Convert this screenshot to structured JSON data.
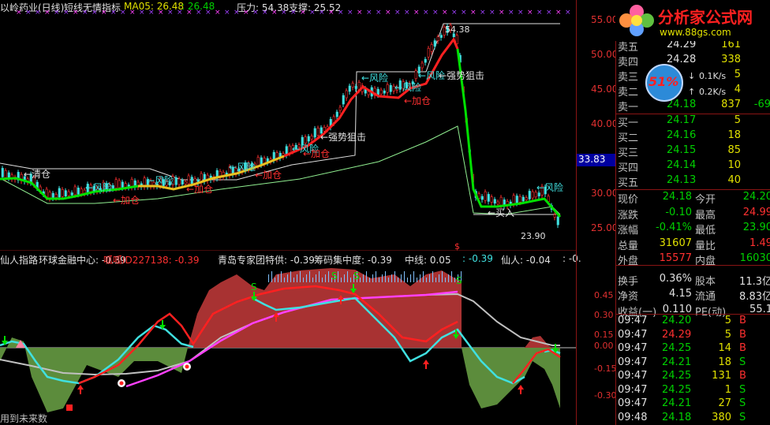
{
  "header": {
    "stock_title": "以岭药业(日线)",
    "indicator_name": "短线无情指标",
    "ma_label": "MA05: 26.48",
    "ma_value2": ": 26.48",
    "pressure": "压力: 54.38",
    "support": "支撑: 25.52"
  },
  "main_chart": {
    "y_ticks": [
      "55.00",
      "50.00",
      "45.00",
      "40.00",
      "35.00",
      "30.00",
      "25.00"
    ],
    "current_price_tag": "33.83",
    "high_label": "54.38",
    "low_label": "23.90",
    "annotations": {
      "qingcang": "←清仓",
      "fengxian": "←风险",
      "jiacang": "←加仓",
      "qiangshi": "←强势狙击",
      "mairu": "←买入"
    }
  },
  "indicator": {
    "name": "仙人指路",
    "items": [
      {
        "label": "环球金融中心: -0.39",
        "color": "#e0e0e0"
      },
      {
        "label": "呱呱ID227138: -0.39",
        "color": "#ff3030"
      },
      {
        "label": "青岛专家团特供: -0.39",
        "color": "#e0e0e0"
      },
      {
        "label": "筹码集中度: -0.39",
        "color": "#e0e0e0"
      },
      {
        "label": "中线: 0.05",
        "color": "#e0e0e0"
      },
      {
        "label": ": -0.39",
        "color": "#40e0e0"
      },
      {
        "label": "仙人: -0.04",
        "color": "#e0e0e0"
      },
      {
        "label": ": -0.",
        "color": "#e0e0e0"
      }
    ],
    "y_ticks": [
      "0.45",
      "0.30",
      "0.15",
      "0.00",
      "-0.15",
      "-0.30"
    ],
    "footer": "用到未来数"
  },
  "logo": {
    "title": "分析家公式网",
    "url": "www.88gs.com"
  },
  "speed": {
    "percent": "51%",
    "down": "0.1K/s",
    "up": "0.2K/s"
  },
  "order_book": {
    "asks": [
      {
        "label": "卖五",
        "price": "24.29",
        "vol": "161",
        "chg": ""
      },
      {
        "label": "卖四",
        "price": "24.28",
        "vol": "338",
        "chg": ""
      },
      {
        "label": "卖三",
        "price": "",
        "vol": "5",
        "chg": ""
      },
      {
        "label": "卖二",
        "price": "",
        "vol": "4",
        "chg": ""
      },
      {
        "label": "卖一",
        "price": "24.18",
        "vol": "837",
        "chg": "-69"
      }
    ],
    "bids": [
      {
        "label": "买一",
        "price": "24.17",
        "vol": "5"
      },
      {
        "label": "买二",
        "price": "24.16",
        "vol": "18"
      },
      {
        "label": "买三",
        "price": "24.15",
        "vol": "85"
      },
      {
        "label": "买四",
        "price": "24.14",
        "vol": "10"
      },
      {
        "label": "买五",
        "price": "24.13",
        "vol": "40"
      }
    ]
  },
  "quote": [
    {
      "l1": "现价",
      "v1": "24.18",
      "c1": "#00d000",
      "l2": "今开",
      "v2": "24.20",
      "c2": "#00d000"
    },
    {
      "l1": "涨跌",
      "v1": "-0.10",
      "c1": "#00d000",
      "l2": "最高",
      "v2": "24.99",
      "c2": "#ff3030"
    },
    {
      "l1": "涨幅",
      "v1": "-0.41%",
      "c1": "#00d000",
      "l2": "最低",
      "v2": "23.90",
      "c2": "#00d000"
    },
    {
      "l1": "总量",
      "v1": "31607",
      "c1": "#e0e000",
      "l2": "量比",
      "v2": "1.49",
      "c2": "#ff3030"
    },
    {
      "l1": "外盘",
      "v1": "15577",
      "c1": "#ff3030",
      "l2": "内盘",
      "v2": "16030",
      "c2": "#00d000"
    },
    {
      "l1": "换手",
      "v1": "0.36%",
      "c1": "#e0e0e0",
      "l2": "股本",
      "v2": "11.3亿",
      "c2": "#e0e0e0"
    },
    {
      "l1": "净资",
      "v1": "4.15",
      "c1": "#e0e0e0",
      "l2": "流通",
      "v2": "8.83亿",
      "c2": "#e0e0e0"
    },
    {
      "l1": "收益(一)",
      "v1": "0.110",
      "c1": "#e0e0e0",
      "l2": "PE(动)",
      "v2": "55.1",
      "c2": "#e0e0e0"
    }
  ],
  "ticks": [
    {
      "time": "09:47",
      "price": "24.20",
      "pc": "#00d000",
      "vol": "5",
      "side": "B"
    },
    {
      "time": "09:47",
      "price": "24.29",
      "pc": "#ff3030",
      "vol": "5",
      "side": "B"
    },
    {
      "time": "09:47",
      "price": "24.25",
      "pc": "#00d000",
      "vol": "14",
      "side": "B"
    },
    {
      "time": "09:47",
      "price": "24.21",
      "pc": "#00d000",
      "vol": "18",
      "side": "S"
    },
    {
      "time": "09:47",
      "price": "24.25",
      "pc": "#00d000",
      "vol": "131",
      "side": "B"
    },
    {
      "time": "09:47",
      "price": "24.25",
      "pc": "#00d000",
      "vol": "1",
      "side": "S"
    },
    {
      "time": "09:47",
      "price": "24.21",
      "pc": "#00d000",
      "vol": "27",
      "side": "S"
    },
    {
      "time": "09:48",
      "price": "24.18",
      "pc": "#00d000",
      "vol": "380",
      "side": "S"
    }
  ],
  "colors": {
    "up": "#ff3030",
    "down": "#00d000",
    "grid": "#8a1414",
    "fill_pos": "#a83232",
    "fill_neg": "#5c8c3c"
  }
}
